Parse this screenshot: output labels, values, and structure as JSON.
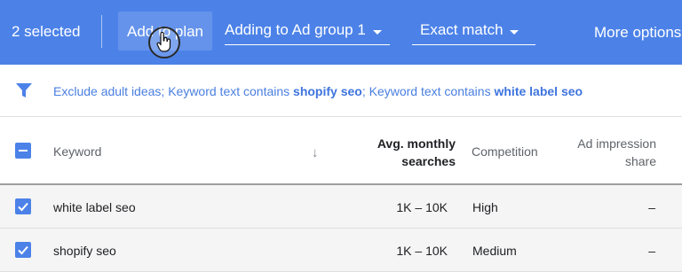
{
  "action_bar": {
    "selected_count": "2 selected",
    "add_to_plan_label": "Add to plan",
    "ad_group_dropdown": "Adding to Ad group 1",
    "match_type_dropdown": "Exact match",
    "more_options_label": "More options",
    "background_color": "#4c82e8"
  },
  "filter": {
    "icon": "filter-icon",
    "part1": "Exclude adult ideas; Keyword text contains ",
    "term1": "shopify seo",
    "part2": "; Keyword text contains ",
    "term2": "white label seo"
  },
  "table": {
    "columns": {
      "keyword": "Keyword",
      "sort_icon": "arrow-down-icon",
      "searches": "Avg. monthly searches",
      "competition": "Competition",
      "share": "Ad impression share"
    },
    "rows": [
      {
        "keyword": "white label seo",
        "searches": "1K – 10K",
        "competition": "High",
        "share": "–",
        "checked": true
      },
      {
        "keyword": "shopify seo",
        "searches": "1K – 10K",
        "competition": "Medium",
        "share": "–",
        "checked": true
      }
    ]
  }
}
